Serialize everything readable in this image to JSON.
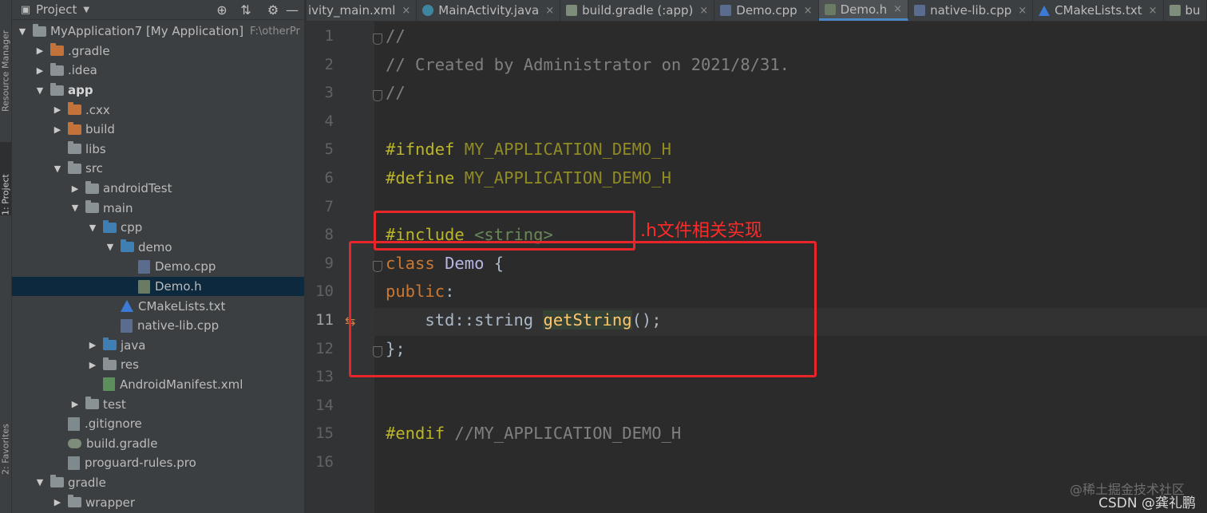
{
  "left_strip": {
    "tabs": [
      {
        "label": "Resource Manager",
        "active": false
      },
      {
        "label": "1: Project",
        "active": true
      },
      {
        "label": "2: Favorites",
        "active": false
      }
    ]
  },
  "project_panel": {
    "title": "Project",
    "tree": [
      {
        "depth": 0,
        "arrow": "open",
        "icon": "module",
        "label": "MyApplication7 [My Application]",
        "bold": false,
        "path": "F:\\otherPr"
      },
      {
        "depth": 1,
        "arrow": "closed",
        "icon": "folder-orange",
        "label": ".gradle"
      },
      {
        "depth": 1,
        "arrow": "closed",
        "icon": "folder-gray",
        "label": ".idea"
      },
      {
        "depth": 1,
        "arrow": "open",
        "icon": "folder-module",
        "label": "app",
        "bold": true
      },
      {
        "depth": 2,
        "arrow": "closed",
        "icon": "folder-orange",
        "label": ".cxx"
      },
      {
        "depth": 2,
        "arrow": "closed",
        "icon": "folder-orange",
        "label": "build"
      },
      {
        "depth": 2,
        "arrow": "none",
        "icon": "folder-gray",
        "label": "libs"
      },
      {
        "depth": 2,
        "arrow": "open",
        "icon": "folder-gray",
        "label": "src"
      },
      {
        "depth": 3,
        "arrow": "closed",
        "icon": "folder-gray",
        "label": "androidTest"
      },
      {
        "depth": 3,
        "arrow": "open",
        "icon": "folder-gray",
        "label": "main"
      },
      {
        "depth": 4,
        "arrow": "open",
        "icon": "folder-blue",
        "label": "cpp"
      },
      {
        "depth": 5,
        "arrow": "open",
        "icon": "folder-blue",
        "label": "demo"
      },
      {
        "depth": 6,
        "arrow": "none",
        "icon": "file-cpp",
        "label": "Demo.cpp"
      },
      {
        "depth": 6,
        "arrow": "none",
        "icon": "file-h",
        "label": "Demo.h",
        "selected": true
      },
      {
        "depth": 5,
        "arrow": "none",
        "icon": "file-cmake",
        "label": "CMakeLists.txt"
      },
      {
        "depth": 5,
        "arrow": "none",
        "icon": "file-cpp",
        "label": "native-lib.cpp"
      },
      {
        "depth": 4,
        "arrow": "closed",
        "icon": "folder-blue",
        "label": "java"
      },
      {
        "depth": 4,
        "arrow": "closed",
        "icon": "folder-gray",
        "label": "res"
      },
      {
        "depth": 4,
        "arrow": "none",
        "icon": "file-xml",
        "label": "AndroidManifest.xml"
      },
      {
        "depth": 3,
        "arrow": "closed",
        "icon": "folder-gray",
        "label": "test"
      },
      {
        "depth": 2,
        "arrow": "none",
        "icon": "file-txt",
        "label": ".gitignore"
      },
      {
        "depth": 2,
        "arrow": "none",
        "icon": "file-gradle",
        "label": "build.gradle"
      },
      {
        "depth": 2,
        "arrow": "none",
        "icon": "file-txt",
        "label": "proguard-rules.pro"
      },
      {
        "depth": 1,
        "arrow": "open",
        "icon": "folder-gray",
        "label": "gradle"
      },
      {
        "depth": 2,
        "arrow": "closed",
        "icon": "folder-gray",
        "label": "wrapper"
      }
    ]
  },
  "editor_tabs": [
    {
      "label": "ivity_main.xml",
      "icon": "none",
      "color": "",
      "active": false
    },
    {
      "label": "MainActivity.java",
      "icon": "java",
      "color": "#3e86a0",
      "active": false
    },
    {
      "label": "build.gradle (:app)",
      "icon": "gradle",
      "color": "#7e8c7a",
      "active": false
    },
    {
      "label": "Demo.cpp",
      "icon": "cpp",
      "color": "#5a6d8e",
      "active": false
    },
    {
      "label": "Demo.h",
      "icon": "h",
      "color": "#6b7b63",
      "active": true
    },
    {
      "label": "native-lib.cpp",
      "icon": "cpp",
      "color": "#5a6d8e",
      "active": false
    },
    {
      "label": "CMakeLists.txt",
      "icon": "cmake",
      "color": "#3b7bd6",
      "active": false
    },
    {
      "label": "bu",
      "icon": "gradle",
      "color": "#7e8c7a",
      "active": false
    }
  ],
  "code": {
    "current_line": 11,
    "lines": [
      {
        "n": "1",
        "tokens": [
          {
            "t": "//",
            "c": "comment"
          }
        ]
      },
      {
        "n": "2",
        "tokens": [
          {
            "t": "// Created by Administrator on 2021/8/31.",
            "c": "comment"
          }
        ]
      },
      {
        "n": "3",
        "tokens": [
          {
            "t": "//",
            "c": "comment"
          }
        ]
      },
      {
        "n": "4",
        "tokens": []
      },
      {
        "n": "5",
        "tokens": [
          {
            "t": "#ifndef ",
            "c": "pre"
          },
          {
            "t": "MY_APPLICATION_DEMO_H",
            "c": "macro"
          }
        ]
      },
      {
        "n": "6",
        "tokens": [
          {
            "t": "#define ",
            "c": "pre"
          },
          {
            "t": "MY_APPLICATION_DEMO_H",
            "c": "macro"
          }
        ]
      },
      {
        "n": "7",
        "tokens": []
      },
      {
        "n": "8",
        "tokens": [
          {
            "t": "#include ",
            "c": "pre"
          },
          {
            "t": "<string>",
            "c": "str"
          }
        ]
      },
      {
        "n": "9",
        "tokens": [
          {
            "t": "class ",
            "c": "kw"
          },
          {
            "t": "Demo",
            "c": "cls"
          },
          {
            "t": " {",
            "c": "plain"
          }
        ]
      },
      {
        "n": "10",
        "tokens": [
          {
            "t": "public",
            "c": "kw"
          },
          {
            "t": ":",
            "c": "plain"
          }
        ]
      },
      {
        "n": "11",
        "tokens": [
          {
            "t": "    std::string ",
            "c": "plain"
          },
          {
            "t": "getString",
            "c": "fn"
          },
          {
            "t": "();",
            "c": "plain"
          }
        ]
      },
      {
        "n": "12",
        "tokens": [
          {
            "t": "};",
            "c": "plain"
          }
        ]
      },
      {
        "n": "13",
        "tokens": []
      },
      {
        "n": "14",
        "tokens": []
      },
      {
        "n": "15",
        "tokens": [
          {
            "t": "#endif ",
            "c": "pre"
          },
          {
            "t": "//MY_APPLICATION_DEMO_H",
            "c": "comment"
          }
        ]
      },
      {
        "n": "16",
        "tokens": []
      }
    ]
  },
  "annotation": {
    "note": ".h文件相关实现",
    "color": "#e8262a"
  },
  "watermark": {
    "juejin": "@稀土掘金技术社区",
    "csdn": "CSDN @龚礼鹏"
  }
}
